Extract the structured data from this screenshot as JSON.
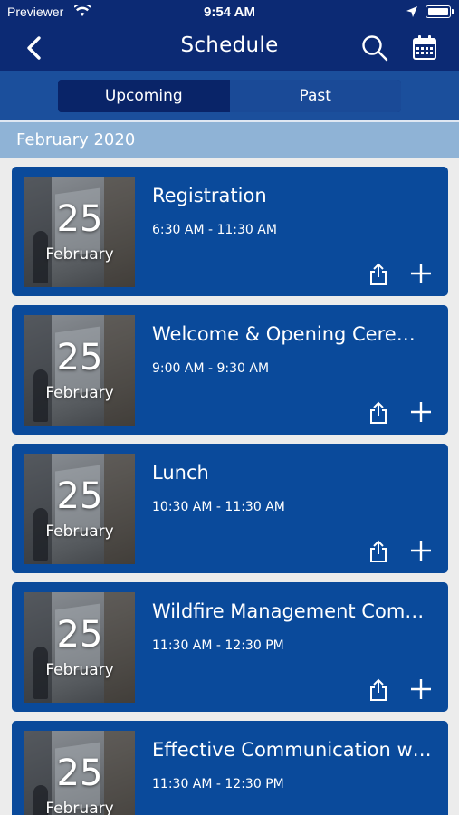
{
  "status": {
    "carrier": "Previewer",
    "time": "9:54 AM"
  },
  "nav": {
    "title": "Schedule",
    "icons": [
      "back-chevron-icon",
      "search-icon",
      "calendar-icon"
    ]
  },
  "tabs": [
    {
      "label": "Upcoming",
      "active": true
    },
    {
      "label": "Past",
      "active": false
    }
  ],
  "section": {
    "month": "February 2020"
  },
  "events": [
    {
      "day": "25",
      "month": "February",
      "title": "Registration",
      "time": "6:30 AM - 11:30 AM"
    },
    {
      "day": "25",
      "month": "February",
      "title": "Welcome & Opening Ceremony",
      "time": "9:00 AM - 9:30 AM"
    },
    {
      "day": "25",
      "month": "February",
      "title": "Lunch",
      "time": "10:30 AM - 11:30 AM"
    },
    {
      "day": "25",
      "month": "February",
      "title": "Wildfire Management Committee",
      "time": "11:30 AM - 12:30 PM"
    },
    {
      "day": "25",
      "month": "February",
      "title": "Effective Communication with",
      "time": "11:30 AM - 12:30 PM"
    }
  ],
  "colors": {
    "nav_bg": "#0c2a74",
    "segment_bg": "#1b4f9c",
    "month_bar": "#8fb3d6",
    "card_bg": "#0a4a9b"
  }
}
